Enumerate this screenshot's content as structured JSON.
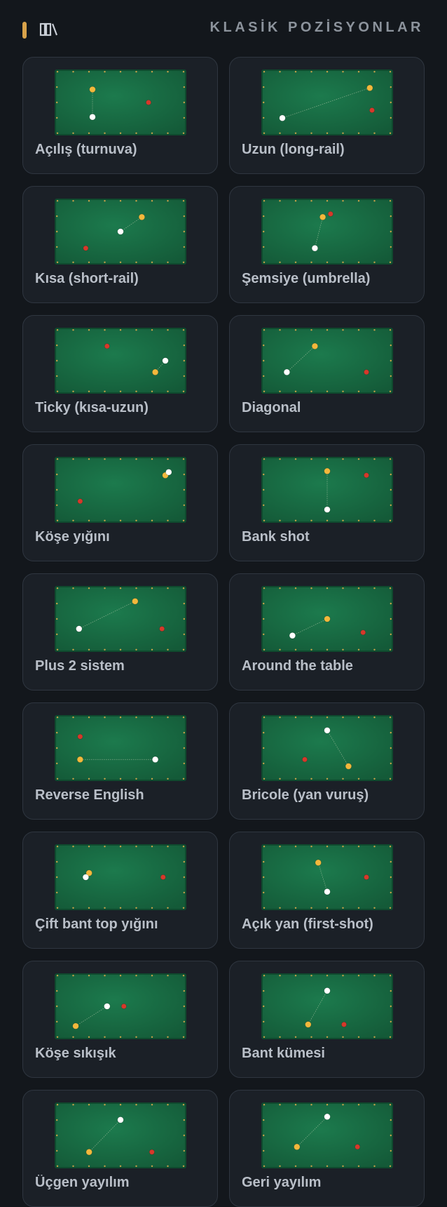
{
  "header": {
    "title": "KLASİK POZİSYONLAR",
    "icon": "book-open-icon",
    "accent_color": "#d8a24a"
  },
  "colors": {
    "cloth": "#1c7a4d",
    "cloth_edge": "#0f4a2e",
    "diamond": "#c9a24a",
    "ball_white": "#ffffff",
    "ball_yellow": "#f2b83c",
    "ball_red": "#d6392b"
  },
  "positions": [
    {
      "label": "Açılış (turnuva)",
      "balls": {
        "white": [
          0.25,
          0.78
        ],
        "yellow": [
          0.25,
          0.25
        ],
        "red": [
          0.75,
          0.5
        ]
      },
      "aim": [
        "white",
        "yellow"
      ]
    },
    {
      "label": "Uzun (long-rail)",
      "balls": {
        "white": [
          0.1,
          0.8
        ],
        "yellow": [
          0.88,
          0.22
        ],
        "red": [
          0.9,
          0.65
        ]
      },
      "aim": [
        "white",
        "yellow"
      ]
    },
    {
      "label": "Kısa (short-rail)",
      "balls": {
        "white": [
          0.5,
          0.5
        ],
        "yellow": [
          0.69,
          0.22
        ],
        "red": [
          0.19,
          0.82
        ]
      },
      "aim": [
        "white",
        "yellow"
      ]
    },
    {
      "label": "Şemsiye (umbrella)",
      "balls": {
        "white": [
          0.39,
          0.82
        ],
        "yellow": [
          0.46,
          0.22
        ],
        "red": [
          0.53,
          0.16
        ]
      },
      "aim": [
        "white",
        "yellow"
      ]
    },
    {
      "label": "Ticky (kısa-uzun)",
      "balls": {
        "white": [
          0.9,
          0.5
        ],
        "yellow": [
          0.81,
          0.72
        ],
        "red": [
          0.38,
          0.22
        ]
      },
      "aim": [
        "white",
        "yellow"
      ]
    },
    {
      "label": "Diagonal",
      "balls": {
        "white": [
          0.14,
          0.72
        ],
        "yellow": [
          0.39,
          0.22
        ],
        "red": [
          0.85,
          0.72
        ]
      },
      "aim": [
        "white",
        "yellow"
      ]
    },
    {
      "label": "Köşe yığını",
      "balls": {
        "white": [
          0.93,
          0.16
        ],
        "yellow": [
          0.9,
          0.22
        ],
        "red": [
          0.14,
          0.72
        ]
      },
      "aim": []
    },
    {
      "label": "Bank shot",
      "balls": {
        "white": [
          0.5,
          0.88
        ],
        "yellow": [
          0.5,
          0.14
        ],
        "red": [
          0.85,
          0.22
        ]
      },
      "aim": [
        "white",
        "yellow"
      ]
    },
    {
      "label": "Plus 2 sistem",
      "balls": {
        "white": [
          0.13,
          0.69
        ],
        "yellow": [
          0.63,
          0.16
        ],
        "red": [
          0.87,
          0.69
        ]
      },
      "aim": [
        "white",
        "yellow"
      ]
    },
    {
      "label": "Around the table",
      "balls": {
        "white": [
          0.19,
          0.82
        ],
        "yellow": [
          0.5,
          0.5
        ],
        "red": [
          0.82,
          0.76
        ]
      },
      "aim": [
        "white",
        "yellow"
      ]
    },
    {
      "label": "Reverse English",
      "balls": {
        "white": [
          0.81,
          0.72
        ],
        "yellow": [
          0.14,
          0.72
        ],
        "red": [
          0.14,
          0.28
        ]
      },
      "aim": [
        "white",
        "yellow"
      ]
    },
    {
      "label": "Bricole (yan vuruş)",
      "balls": {
        "white": [
          0.5,
          0.16
        ],
        "yellow": [
          0.69,
          0.85
        ],
        "red": [
          0.3,
          0.72
        ]
      },
      "aim": [
        "white",
        "yellow"
      ]
    },
    {
      "label": "Çift bant top yığını",
      "balls": {
        "white": [
          0.19,
          0.5
        ],
        "yellow": [
          0.22,
          0.42
        ],
        "red": [
          0.88,
          0.5
        ]
      },
      "aim": []
    },
    {
      "label": "Açık yan (first-shot)",
      "balls": {
        "white": [
          0.5,
          0.78
        ],
        "yellow": [
          0.42,
          0.22
        ],
        "red": [
          0.85,
          0.5
        ]
      },
      "aim": [
        "white",
        "yellow"
      ]
    },
    {
      "label": "Köşe sıkışık",
      "balls": {
        "white": [
          0.38,
          0.5
        ],
        "yellow": [
          0.1,
          0.88
        ],
        "red": [
          0.53,
          0.5
        ]
      },
      "aim": [
        "white",
        "yellow"
      ]
    },
    {
      "label": "Bant kümesi",
      "balls": {
        "white": [
          0.5,
          0.2
        ],
        "yellow": [
          0.33,
          0.85
        ],
        "red": [
          0.65,
          0.85
        ]
      },
      "aim": [
        "white",
        "yellow"
      ]
    },
    {
      "label": "Üçgen yayılım",
      "balls": {
        "white": [
          0.5,
          0.2
        ],
        "yellow": [
          0.22,
          0.82
        ],
        "red": [
          0.78,
          0.82
        ]
      },
      "aim": [
        "white",
        "yellow"
      ]
    },
    {
      "label": "Geri yayılım",
      "balls": {
        "white": [
          0.5,
          0.14
        ],
        "yellow": [
          0.23,
          0.72
        ],
        "red": [
          0.77,
          0.72
        ]
      },
      "aim": [
        "white",
        "yellow"
      ]
    }
  ]
}
